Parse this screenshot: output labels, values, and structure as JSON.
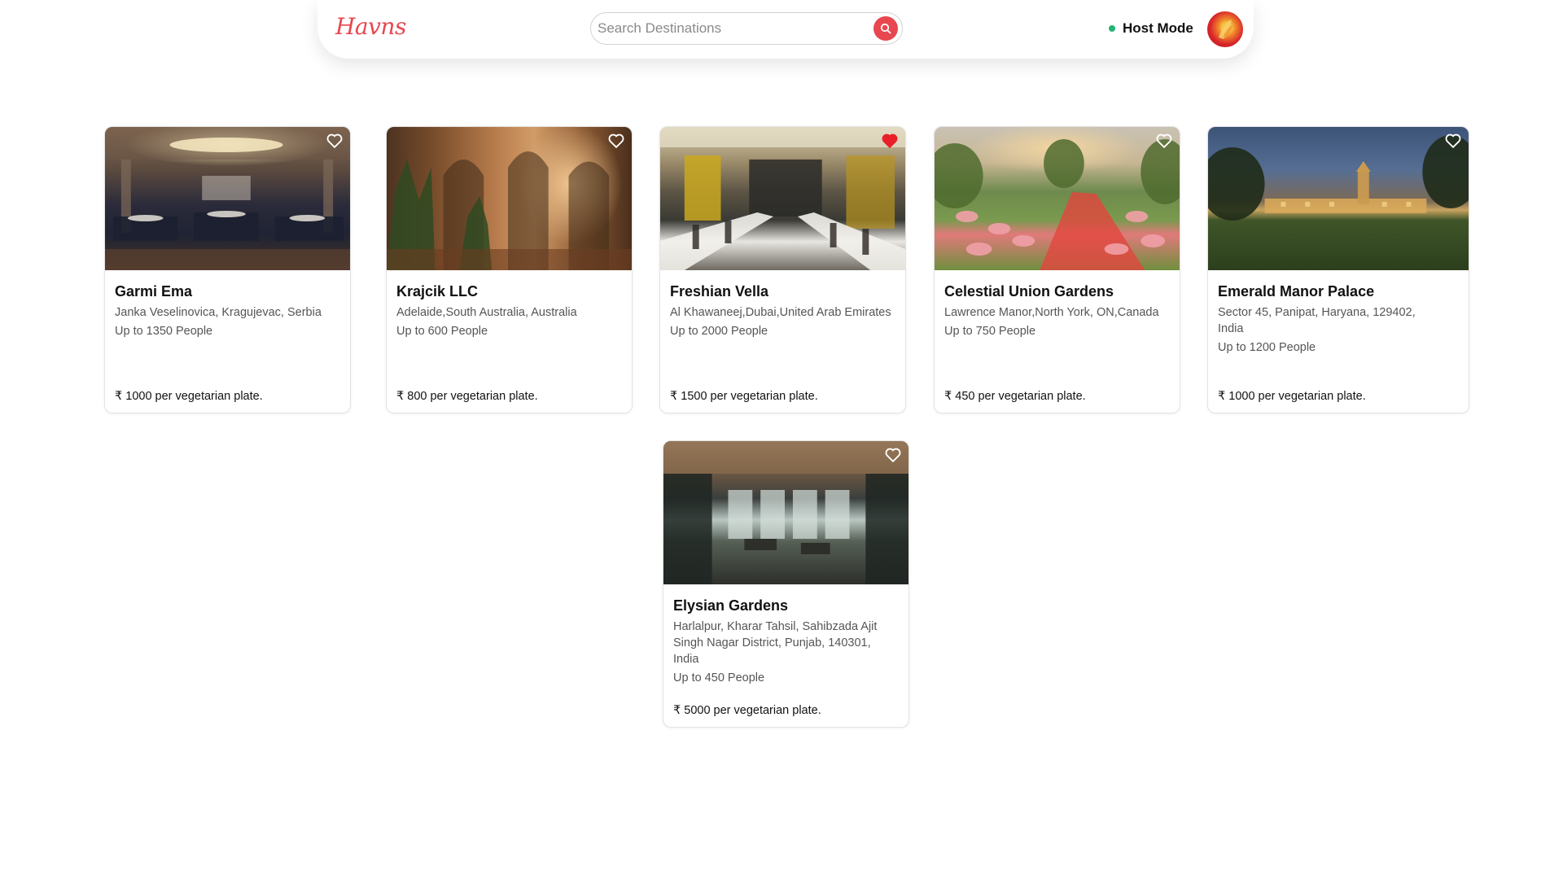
{
  "header": {
    "logo_text": "Havns",
    "search_placeholder": "Search Destinations",
    "host_mode_label": "Host Mode",
    "brand_color": "#e8474f",
    "status_dot_color": "#22b573"
  },
  "venues": [
    {
      "name": "Garmi Ema",
      "address": "Janka Veselinovica, Kragujevac, Serbia",
      "capacity": "Up to 1350 People",
      "price": "₹ 1000 per vegetarian plate.",
      "favorited": false
    },
    {
      "name": "Krajcik LLC",
      "address": "Adelaide,South Australia, Australia",
      "capacity": "Up to 600 People",
      "price": "₹ 800 per vegetarian plate.",
      "favorited": false
    },
    {
      "name": "Freshian Vella",
      "address": "Al Khawaneej,Dubai,United Arab Emirates",
      "capacity": "Up to 2000 People",
      "price": "₹ 1500 per vegetarian plate.",
      "favorited": true
    },
    {
      "name": "Celestial Union Gardens",
      "address": "Lawrence Manor,North York, ON,Canada",
      "capacity": "Up to 750 People",
      "price": "₹ 450 per vegetarian plate.",
      "favorited": false
    },
    {
      "name": "Emerald Manor Palace",
      "address": "Sector 45, Panipat, Haryana, 129402, India",
      "capacity": "Up to 1200 People",
      "price": "₹ 1000 per vegetarian plate.",
      "favorited": false
    },
    {
      "name": "Elysian Gardens",
      "address": "Harlalpur, Kharar Tahsil, Sahibzada Ajit Singh Nagar District, Punjab, 140301, India",
      "capacity": "Up to 450 People",
      "price": "₹ 5000 per vegetarian plate.",
      "favorited": false
    }
  ]
}
